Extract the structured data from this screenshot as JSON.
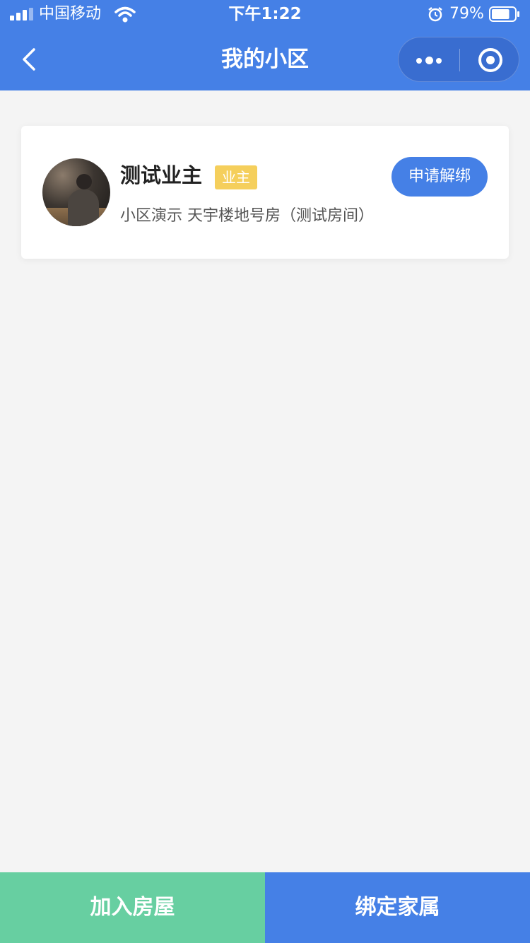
{
  "status_bar": {
    "carrier": "中国移动",
    "time": "下午1:22",
    "battery_percent": "79%",
    "battery_level": 0.79
  },
  "nav": {
    "title": "我的小区",
    "back_icon": "chevron-left-icon",
    "more_icon": "more-dots-icon",
    "close_icon": "target-close-icon"
  },
  "colors": {
    "primary": "#4580e6",
    "secondary": "#67cfa1",
    "badge": "#f5cf5c",
    "background": "#f4f4f4"
  },
  "card": {
    "name": "测试业主",
    "role": "业主",
    "address": "小区演示 天宇楼地号房（测试房间）",
    "unbind_label": "申请解绑"
  },
  "bottom": {
    "join_label": "加入房屋",
    "bind_label": "绑定家属"
  }
}
